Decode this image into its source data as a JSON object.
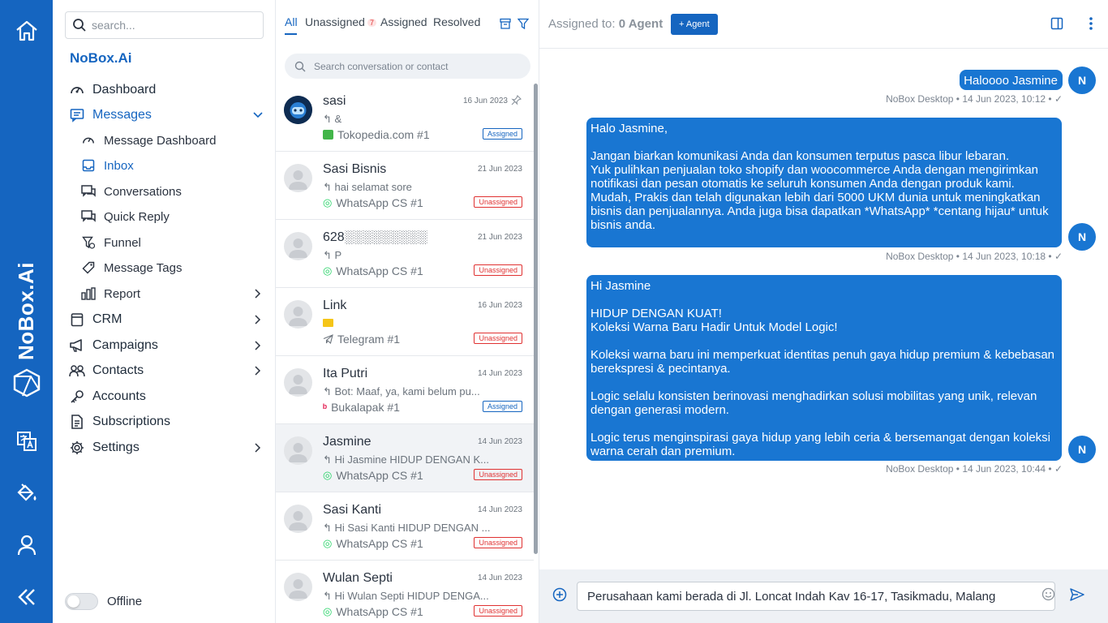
{
  "app": {
    "brand": "NoBox.Ai",
    "org_name": "NoBox.Ai"
  },
  "rail": {
    "items": [
      "home-icon",
      "nobox-logo-icon",
      "translate-icon",
      "paint-bucket-icon",
      "user-icon",
      "collapse-icon"
    ]
  },
  "sidebar": {
    "search_placeholder": "search...",
    "nav": {
      "dashboard": "Dashboard",
      "messages": "Messages",
      "message_dashboard": "Message Dashboard",
      "inbox": "Inbox",
      "conversations": "Conversations",
      "quick_reply": "Quick Reply",
      "funnel": "Funnel",
      "message_tags": "Message Tags",
      "report": "Report",
      "crm": "CRM",
      "campaigns": "Campaigns",
      "contacts": "Contacts",
      "accounts": "Accounts",
      "subscriptions": "Subscriptions",
      "settings": "Settings"
    },
    "status": "Offline"
  },
  "list": {
    "tabs": {
      "all": "All",
      "unassigned": "Unassigned",
      "unassigned_count": "7",
      "assigned": "Assigned",
      "resolved": "Resolved"
    },
    "search_placeholder": "Search conversation or contact",
    "conversations": [
      {
        "name": "sasi",
        "date": "16 Jun 2023",
        "preview": "&",
        "channel": "Tokopedia.com #1",
        "status": "Assigned",
        "pinned": true
      },
      {
        "name": "Sasi Bisnis",
        "date": "21 Jun 2023",
        "preview": "hai selamat sore",
        "channel": "WhatsApp CS #1",
        "status": "Unassigned"
      },
      {
        "name": "628░░░░░░░░░",
        "date": "21 Jun 2023",
        "preview": "P",
        "channel": "WhatsApp CS #1",
        "status": "Unassigned"
      },
      {
        "name": "Link",
        "date": "16 Jun 2023",
        "preview": "",
        "channel": "Telegram #1",
        "status": "Unassigned"
      },
      {
        "name": "Ita Putri",
        "date": "14 Jun 2023",
        "preview": "Bot: Maaf, ya, kami belum pu...",
        "channel": "Bukalapak #1",
        "status": "Assigned"
      },
      {
        "name": "Jasmine",
        "date": "14 Jun 2023",
        "preview": "Hi Jasmine HIDUP DENGAN K...",
        "channel": "WhatsApp CS #1",
        "status": "Unassigned"
      },
      {
        "name": "Sasi Kanti",
        "date": "14 Jun 2023",
        "preview": "Hi Sasi Kanti HIDUP DENGAN ...",
        "channel": "WhatsApp CS #1",
        "status": "Unassigned"
      },
      {
        "name": "Wulan Septi",
        "date": "14 Jun 2023",
        "preview": "Hi Wulan Septi HIDUP DENGA...",
        "channel": "WhatsApp CS #1",
        "status": "Unassigned"
      }
    ]
  },
  "chat": {
    "assigned_label": "Assigned to:",
    "assigned_value": "0 Agent",
    "add_agent": "+ Agent",
    "avatar_initial": "N",
    "messages": [
      {
        "text": "Haloooo Jasmine",
        "meta": "NoBox Desktop • 14 Jun 2023, 10:12 • ✓"
      },
      {
        "text": "Halo Jasmine,\n\nJangan biarkan komunikasi Anda dan konsumen terputus pasca libur lebaran.\nYuk pulihkan penjualan toko shopify dan woocommerce Anda dengan mengirimkan notifikasi dan pesan otomatis ke seluruh konsumen Anda dengan produk kami.\nMudah, Prakis dan telah digunakan lebih dari 5000 UKM dunia untuk meningkatkan bisnis dan penjualannya. Anda juga bisa dapatkan *WhatsApp* *centang hijau* untuk bisnis anda.",
        "meta": "NoBox Desktop • 14 Jun 2023, 10:18 • ✓"
      },
      {
        "text": "Hi Jasmine\n\nHIDUP DENGAN KUAT!\nKoleksi Warna Baru Hadir Untuk Model Logic!\n\nKoleksi warna baru ini memperkuat identitas penuh gaya hidup premium & kebebasan berekspresi & pecintanya.\n\nLogic selalu konsisten berinovasi menghadirkan solusi mobilitas yang unik, relevan dengan generasi modern.\n\nLogic terus menginspirasi gaya hidup yang lebih ceria & bersemangat dengan koleksi warna cerah dan premium.",
        "meta": "NoBox Desktop • 14 Jun 2023, 10:44 • ✓"
      }
    ],
    "composer_value": "Perusahaan kami berada di Jl. Loncat Indah Kav 16-17, Tasikmadu, Malang"
  },
  "colors": {
    "primary": "#1565c0",
    "bubble": "#1976d2",
    "unassigned": "#e03131"
  }
}
